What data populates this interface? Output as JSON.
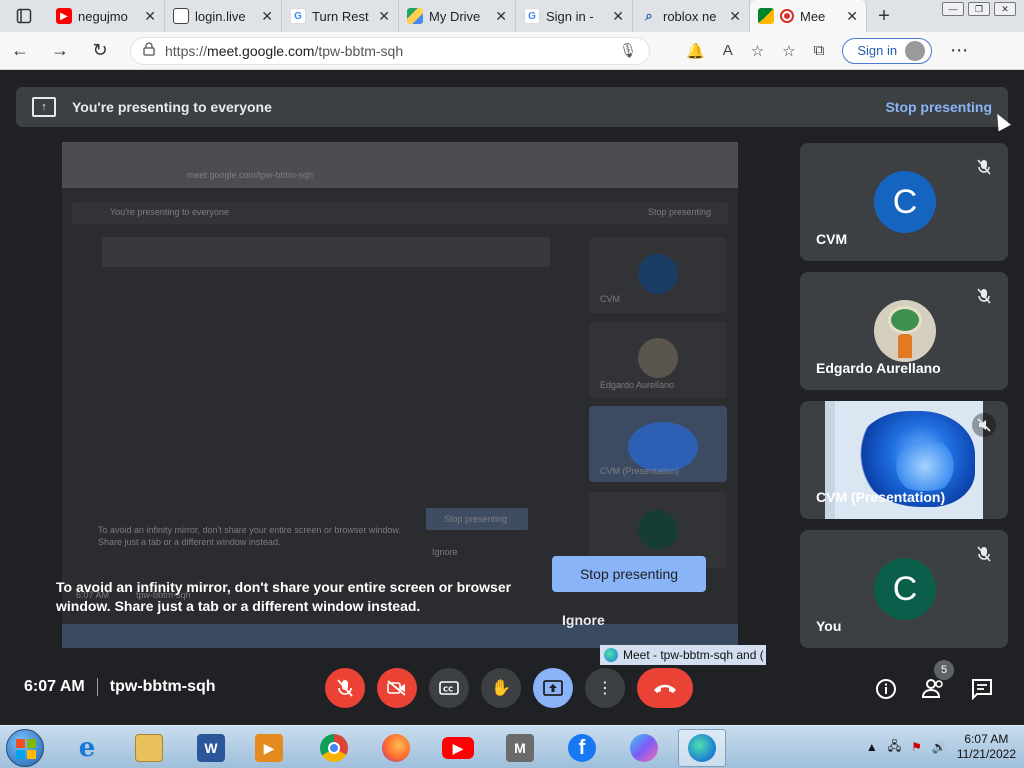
{
  "browser": {
    "tabs": [
      {
        "label": "negujmo",
        "icon": "youtube-icon",
        "color": "#ff0000"
      },
      {
        "label": "login.live",
        "icon": "page-icon",
        "color": "#555555"
      },
      {
        "label": "Turn Rest",
        "icon": "google-icon",
        "color": "#4285f4"
      },
      {
        "label": "My Drive",
        "icon": "drive-icon",
        "color": "#1fa463"
      },
      {
        "label": "Sign in -",
        "icon": "google-icon",
        "color": "#4285f4"
      },
      {
        "label": "roblox ne",
        "icon": "search-icon",
        "color": "#2a5db0"
      },
      {
        "label": "Mee",
        "icon": "meet-icon",
        "color": "#00832d"
      }
    ],
    "url_prefix": "https://",
    "url_host": "meet.google.com",
    "url_path": "/tpw-bbtm-sqh",
    "signin_label": "Sign in"
  },
  "meet": {
    "present_bar": {
      "text": "You're presenting to everyone",
      "stop_label": "Stop presenting"
    },
    "warning": "To avoid an infinity mirror, don't share your entire screen or browser window. Share just a tab or a different window instead.",
    "stop_button": "Stop presenting",
    "ignore_button": "Ignore",
    "window_label": "Meet - tpw-bbtm-sqh and (",
    "participants": [
      {
        "name": "CVM",
        "initial": "C",
        "avatar_color": "#1565c0",
        "muted": true
      },
      {
        "name": "Edgardo Aurellano",
        "initial": "",
        "avatar_color": "#d6cfc0",
        "muted": true
      },
      {
        "name": "CVM (Presentation)",
        "initial": "",
        "avatar_color": "",
        "muted": true
      },
      {
        "name": "You",
        "initial": "C",
        "avatar_color": "#0b5e4a",
        "muted": true
      }
    ],
    "time": "6:07 AM",
    "meeting_code": "tpw-bbtm-sqh",
    "people_count": "5"
  },
  "mirror": {
    "present_text": "You're presenting to everyone",
    "stop_text": "Stop presenting",
    "url": "meet.google.com/tpw-bbtm-sqh",
    "warn": "To avoid an infinity mirror, don't share your entire screen or browser window. Share just a tab or a different window instead.",
    "tile_names": [
      "CVM",
      "Edgardo Aurellano",
      "CVM (Presentation)"
    ],
    "stop_btn": "Stop presenting",
    "ignore": "Ignore",
    "clock": "6:07 AM",
    "code": "tpw-bbtm-sqh"
  },
  "taskbar": {
    "apps": [
      "start-icon",
      "ie-icon",
      "explorer-icon",
      "word-icon",
      "media-icon",
      "chrome-icon",
      "firefox-icon",
      "youtube-icon",
      "m-icon",
      "facebook-icon",
      "copilot-icon",
      "edge-icon"
    ],
    "m_label": "M",
    "time": "6:07 AM",
    "date": "11/21/2022"
  }
}
